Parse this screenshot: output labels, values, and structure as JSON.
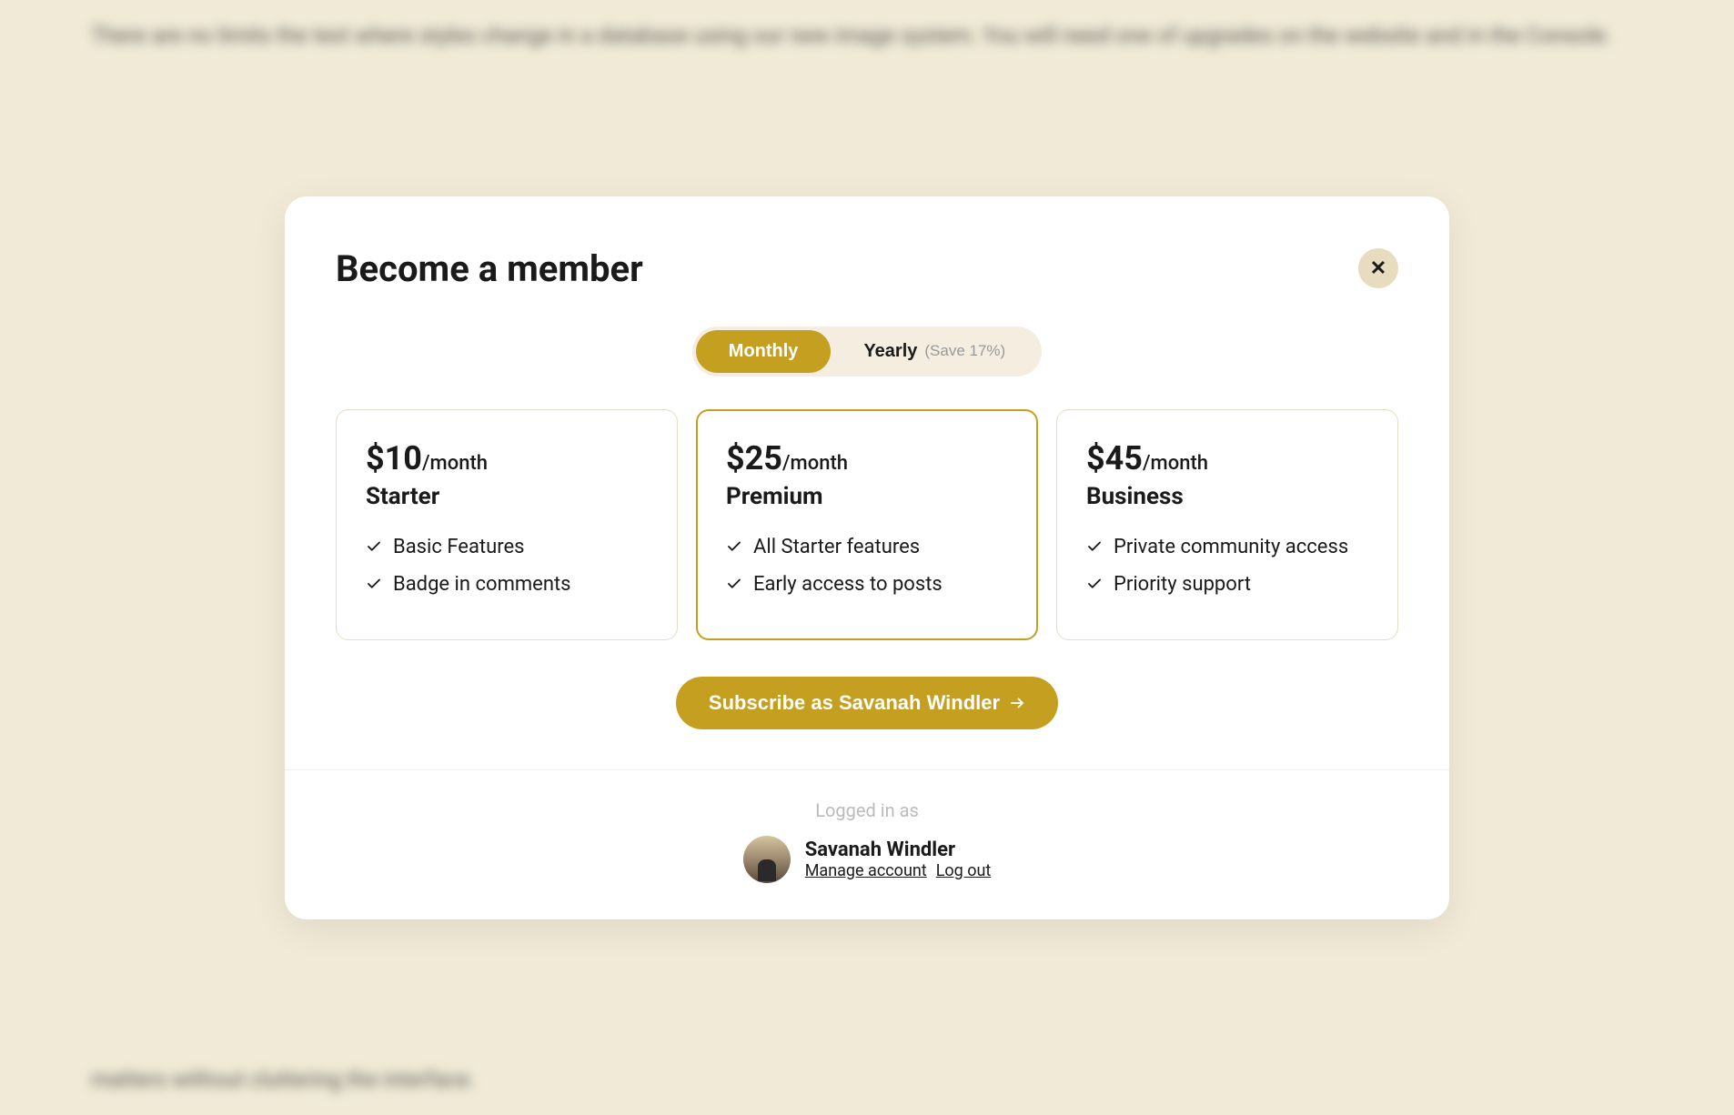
{
  "modal": {
    "title": "Become a member"
  },
  "billing": {
    "monthly_label": "Monthly",
    "yearly_label": "Yearly",
    "savings_label": "(Save 17%)"
  },
  "plans": [
    {
      "price": "$10",
      "period": "/month",
      "name": "Starter",
      "selected": false,
      "features": [
        "Basic Features",
        "Badge in comments"
      ]
    },
    {
      "price": "$25",
      "period": "/month",
      "name": "Premium",
      "selected": true,
      "features": [
        "All Starter features",
        "Early access to posts"
      ]
    },
    {
      "price": "$45",
      "period": "/month",
      "name": "Business",
      "selected": false,
      "features": [
        "Private community access",
        "Priority support"
      ]
    }
  ],
  "subscribe": {
    "label": "Subscribe as Savanah Windler"
  },
  "footer": {
    "logged_in_label": "Logged in as",
    "user_name": "Savanah Windler",
    "manage_account_label": "Manage account",
    "logout_label": "Log out"
  }
}
